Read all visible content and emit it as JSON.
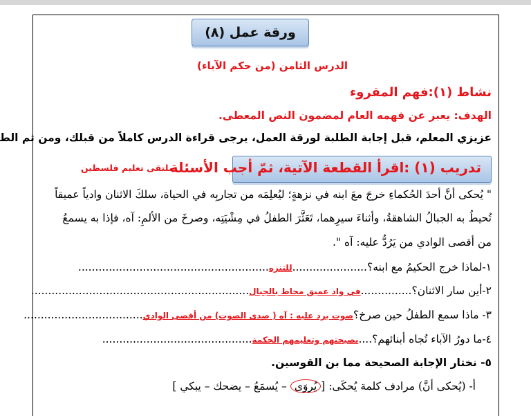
{
  "title": "ورقة عمل (٨)",
  "lesson": "الدرس الثامن (من حكم الآباء)",
  "activity": "نشاط (١):فهم المقروء",
  "goal_label": "الهدف:",
  "goal_text": " يعبر عن فهمه العام لمضمون النص المعطى.",
  "teacher_note": "عزيزي المعلم، قبل إجابة الطلبة لورقة العمل، يرجى قراءة الدرس كاملاً من قبلك، ومن ثم الطلبة.",
  "watermark": "ملتقى تعليم فلسطين",
  "training": "تدريب (١) :اقرأ القطعة الآتية، ثمّ أجب الأسئلة",
  "passage": [
    "\" يُحكى أنَّ أحدَ الحُكماءِ خرجَ معَ ابنه في نزهةٍ؛ ليُعلِمَه من تجاربِه في الحياة، سلكَ الاثنان وادياً عميقاً",
    "تُحيطُ به الجبالُ الشاهقةُ، وأثناءَ سيرِهما، تَعَثَّرَ الطفلُ في مِشْيَتِه، وصرخَ من الألمِ: آه، فإذا به يسمعُ",
    "من أقصى الوادي من يَرُدُّ عليه: آه \"."
  ],
  "questions": [
    {
      "q": "١-لماذا خرج الحكيمُ مع ابنه؟",
      "answer": "للتنزه",
      "dots_before": "......................",
      "dots_after": "........................................................"
    },
    {
      "q": "٢-أين سار الاثنان؟",
      "answer": "في واد عميق محاط بالجبال",
      "dots_before": "...............",
      "dots_after": "................................................................"
    },
    {
      "q": "٣- ماذا سمع الطفلُ حين صرخ؟",
      "answer": "صوت يرد عليه : آه ( صدى الصوت) من أقصى الوادي",
      "dots_before": "",
      "dots_after": "..................................."
    },
    {
      "q": "٤-ما دورُ الآباء تُجاه أبنائهم؟",
      "answer": "نصيحتهم وتعليمهم الحكمة",
      "dots_before": "....",
      "dots_after": "............................................"
    }
  ],
  "q5": "٥- نختار الإجابة الصحيحة مما بن القوسين.",
  "q5a_prefix": "أ- (يُحكى أنَّ) مرادف كلمة يُحكَى:",
  "q5a_options": {
    "open": "[",
    "circled": "يُروَى",
    "rest": " – يُسمَعُ – يضحك – يبكي ",
    "close": "]"
  }
}
